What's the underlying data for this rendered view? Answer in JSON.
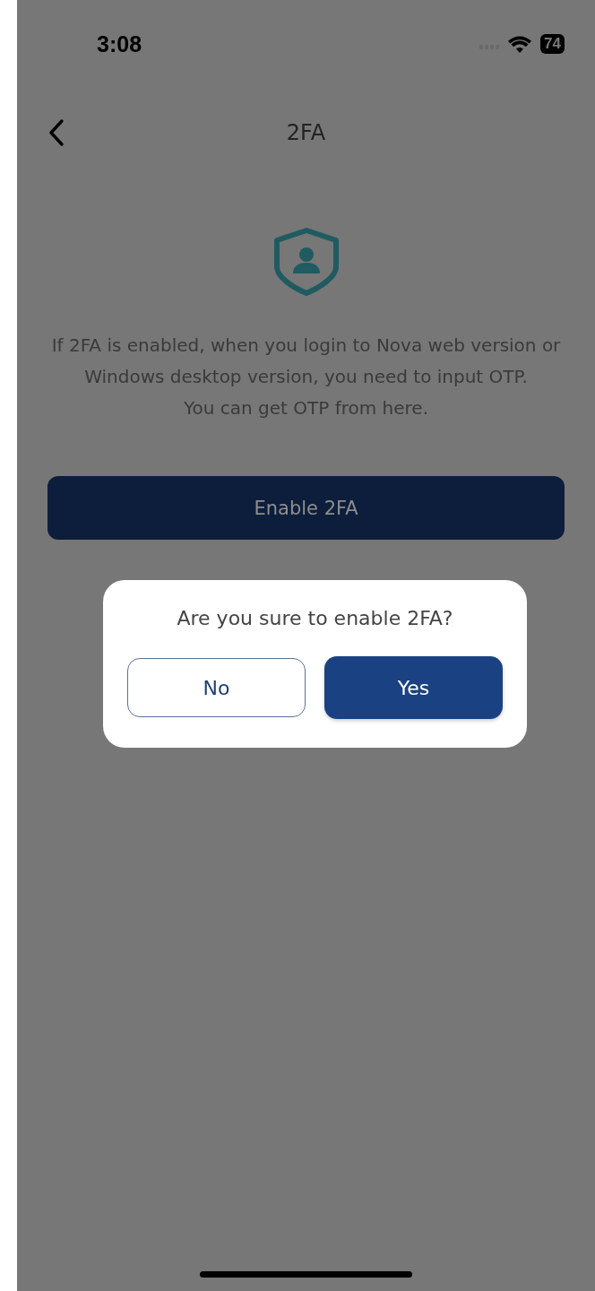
{
  "status_bar": {
    "time": "3:08",
    "battery": "74"
  },
  "nav": {
    "title": "2FA"
  },
  "description": [
    "If 2FA is enabled, when you login to Nova web version or Windows desktop version, you need to input OTP.",
    "You can get OTP from here."
  ],
  "primary_button": {
    "label": "Enable 2FA"
  },
  "dialog": {
    "message": "Are you sure to enable 2FA?",
    "buttons": [
      {
        "label": "No",
        "kind": "outline"
      },
      {
        "label": "Yes",
        "kind": "filled"
      }
    ]
  }
}
